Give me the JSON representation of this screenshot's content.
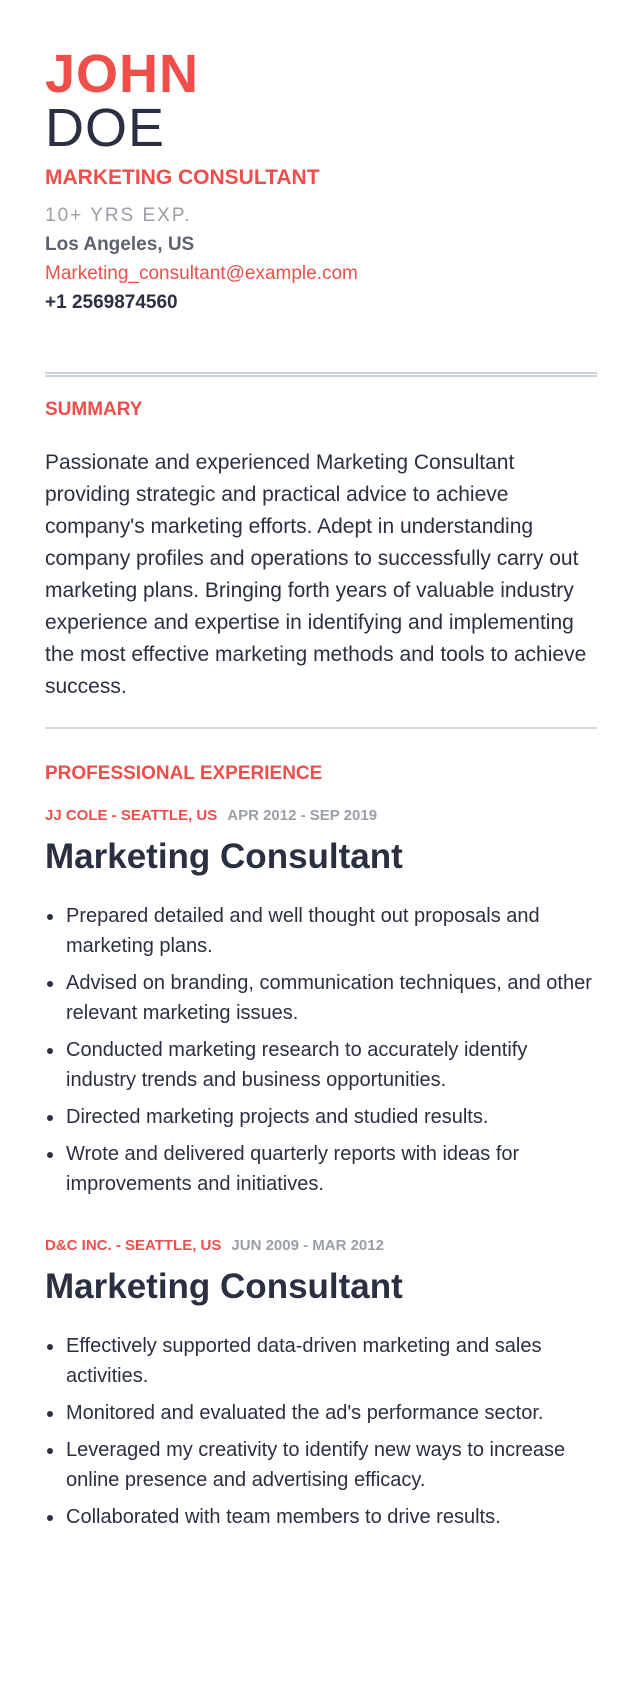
{
  "header": {
    "first_name": "JOHN",
    "last_name": "DOE",
    "title": "MARKETING CONSULTANT",
    "experience": "10+ YRS EXP.",
    "location": "Los Angeles, US",
    "email": "Marketing_consultant@example.com",
    "phone": "+1 2569874560"
  },
  "summary": {
    "heading": "SUMMARY",
    "text": "Passionate and experienced Marketing Consultant providing strategic and practical advice to achieve company's marketing efforts. Adept in understanding company profiles and operations to successfully carry out marketing plans. Bringing forth years of valuable industry experience and expertise in identifying and implementing the most effective marketing methods and tools to achieve success."
  },
  "experience": {
    "heading": "PROFESSIONAL EXPERIENCE",
    "jobs": [
      {
        "company": "JJ COLE - SEATTLE, US",
        "dates": "APR 2012 - SEP 2019",
        "role": "Marketing Consultant",
        "bullets": [
          "Prepared detailed and well thought out proposals and marketing plans.",
          "Advised on branding, communication techniques, and other relevant marketing issues.",
          "Conducted marketing research to accurately identify industry trends and business opportunities.",
          "Directed marketing projects and studied results.",
          "Wrote and delivered quarterly reports with ideas for improvements and initiatives."
        ]
      },
      {
        "company": "D&C INC. - SEATTLE, US",
        "dates": "JUN 2009 - MAR 2012",
        "role": "Marketing Consultant",
        "bullets": [
          "Effectively supported data-driven marketing and sales activities.",
          "Monitored and evaluated the ad's performance sector.",
          "Leveraged my creativity to identify new ways to increase online presence and advertising efficacy.",
          "Collaborated with team members to drive results."
        ]
      }
    ]
  },
  "colors": {
    "accent": "#ef4e4b",
    "text_dark": "#2a3042",
    "text_muted": "#9a9ea6",
    "rule": "#c9d3e0"
  }
}
